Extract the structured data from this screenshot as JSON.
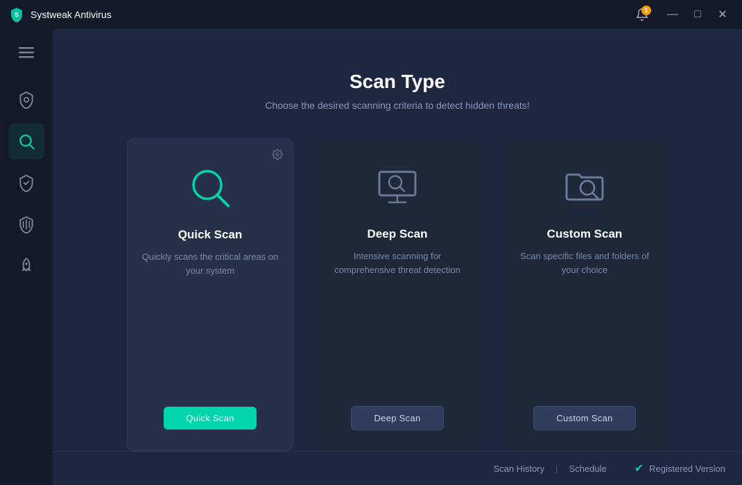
{
  "titleBar": {
    "appName": "Systweak Antivirus",
    "notificationCount": "1",
    "btnMinimize": "—",
    "btnMaximize": "□",
    "btnClose": "✕"
  },
  "sidebar": {
    "menuIcon": "☰",
    "items": [
      {
        "id": "protection",
        "label": "Protection",
        "active": false
      },
      {
        "id": "scan",
        "label": "Scan",
        "active": true
      },
      {
        "id": "shield-check",
        "label": "Shield",
        "active": false
      },
      {
        "id": "firewall",
        "label": "Firewall",
        "active": false
      },
      {
        "id": "booster",
        "label": "Booster",
        "active": false
      }
    ]
  },
  "pageHeader": {
    "title": "Scan Type",
    "subtitle": "Choose the desired scanning criteria to detect hidden threats!"
  },
  "scanCards": [
    {
      "id": "quick",
      "title": "Quick Scan",
      "description": "Quickly scans the critical areas on your system",
      "buttonLabel": "Quick Scan",
      "buttonStyle": "primary",
      "active": true,
      "hasSettings": true
    },
    {
      "id": "deep",
      "title": "Deep Scan",
      "description": "Intensive scanning for comprehensive threat detection",
      "buttonLabel": "Deep Scan",
      "buttonStyle": "secondary",
      "active": false,
      "hasSettings": false
    },
    {
      "id": "custom",
      "title": "Custom Scan",
      "description": "Scan specific files and folders of your choice",
      "buttonLabel": "Custom Scan",
      "buttonStyle": "secondary",
      "active": false,
      "hasSettings": false
    }
  ],
  "footer": {
    "scanHistoryLabel": "Scan History",
    "divider": "|",
    "scheduleLabel": "Schedule",
    "registeredLabel": "Registered Version"
  }
}
